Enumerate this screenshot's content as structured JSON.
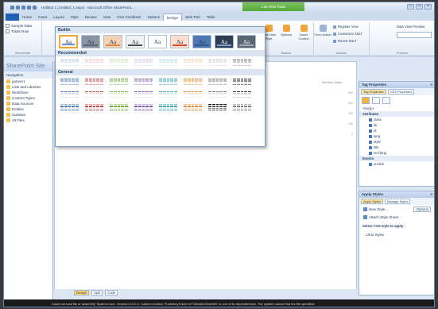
{
  "window": {
    "title": "Untitled 1 (Untitled_1.aspx) - Microsoft Office SharePoint...",
    "context_tab_group": "List View Tools"
  },
  "ribbon_tabs": [
    "Home",
    "Insert",
    "Layout",
    "Style",
    "Review",
    "View",
    "Give Feedback",
    "Options",
    "Design",
    "Web Part",
    "Table"
  ],
  "ribbon": {
    "show_hide": {
      "items": [
        "Sample Data",
        "Totals Row"
      ],
      "label": "Show/Hide"
    },
    "buttons": [
      {
        "label": "Data View Style",
        "icon": "data-view-style-icon"
      },
      {
        "label": "Options",
        "icon": "options-icon"
      },
      {
        "label": "Insert Control",
        "icon": "insert-control-icon"
      },
      {
        "label": "Form Action",
        "icon": "form-action-icon"
      }
    ],
    "register_view": "Register View",
    "customize_xslt": "Customize XSLT",
    "revert_xslt": "Revert XSLT",
    "data_view_preview": "Data View Preview:",
    "group_labels": {
      "toolbar": "Toolbar",
      "actions": "Actions",
      "preview": "Preview"
    }
  },
  "gallery": {
    "builtin_header": "Builtin",
    "recommended_header": "Recommended",
    "general_header": "General",
    "sample_glyph": "Aa"
  },
  "nav": {
    "title": "SharePoint Site",
    "section": "Navigation",
    "items": [
      "gohere1",
      "Lists and Libraries",
      "Workflows",
      "Content Types",
      "Data Sources",
      "Entities",
      "Subsites",
      "All Files"
    ]
  },
  "editor": {
    "column_label": "Monthly Sales",
    "numbers": [
      "400",
      "300",
      "200",
      "100",
      "0"
    ],
    "view_tabs": [
      "Design",
      "Split",
      "Code"
    ]
  },
  "tag_properties": {
    "title": "Tag Properties",
    "tabs": [
      "Tag Properties",
      "CSS Properties"
    ],
    "tag_label": "<body>",
    "attributes_header": "Attributes",
    "attributes": [
      "class",
      "dir",
      "id",
      "lang",
      "style",
      "title",
      "xml:lang"
    ],
    "events_header": "Events",
    "events": [
      "onclick"
    ]
  },
  "apply_styles": {
    "title": "Apply Styles",
    "tabs": [
      "Apply Styles",
      "Manage Styles"
    ],
    "new_style": "New Style...",
    "options": "Options",
    "attach": "Attach Style Sheet...",
    "select_label": "Select CSS style to apply:",
    "clear": "Clear Styles"
  },
  "status_message": "Could not load file or assembly 'System.Core, Version=3.5.0.0, Culture=neutral, PublicKeyToken=b77a5c561934e089' or one of its dependencies. The system cannot find the file specified."
}
